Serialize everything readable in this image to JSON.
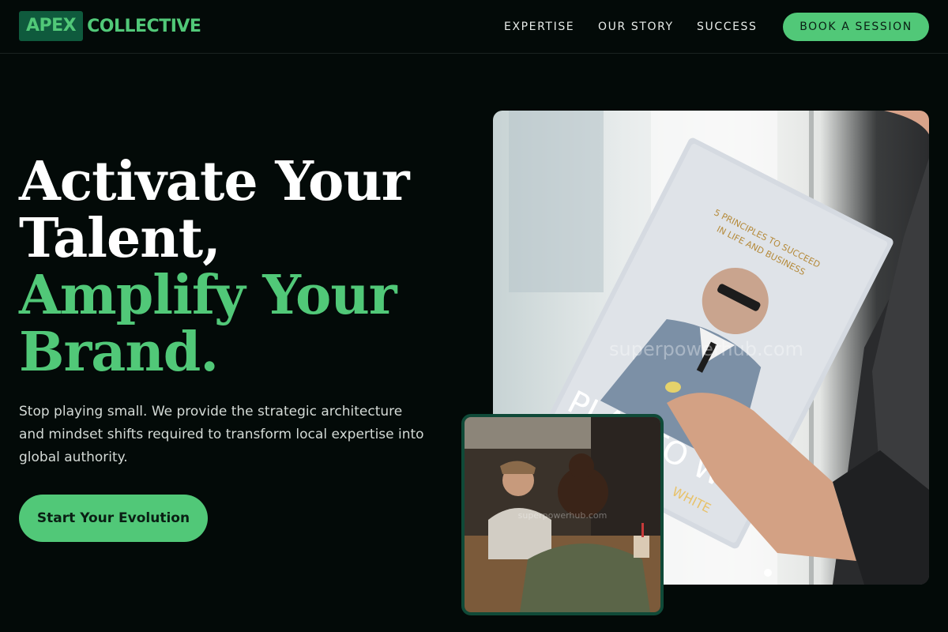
{
  "nav": {
    "logo_box": "APEX",
    "logo_rest": "COLLECTIVE",
    "links": [
      "EXPERTISE",
      "OUR STORY",
      "SUCCESS"
    ],
    "cta": "BOOK A SESSION"
  },
  "hero": {
    "headline_line1": "Activate Your",
    "headline_line2": "Talent,",
    "headline_line3": "Amplify Your",
    "headline_line4": "Brand.",
    "subtext": "Stop playing small. We provide the strategic architecture and mindset shifts required to transform local expertise into global authority.",
    "cta": "Start Your Evolution"
  },
  "images": {
    "main_book_tagline_1": "5 PRINCIPLES TO SUCCEED",
    "main_book_tagline_2": "IN LIFE AND BUSINESS",
    "main_book_title": "PLAY TO WIN",
    "main_book_author": "WHITE",
    "watermark": "superpowerhub.com"
  },
  "colors": {
    "background": "#030a08",
    "accent_green": "#51c878",
    "logo_box": "#0f5a3d",
    "inset_border": "#0f4a38"
  }
}
